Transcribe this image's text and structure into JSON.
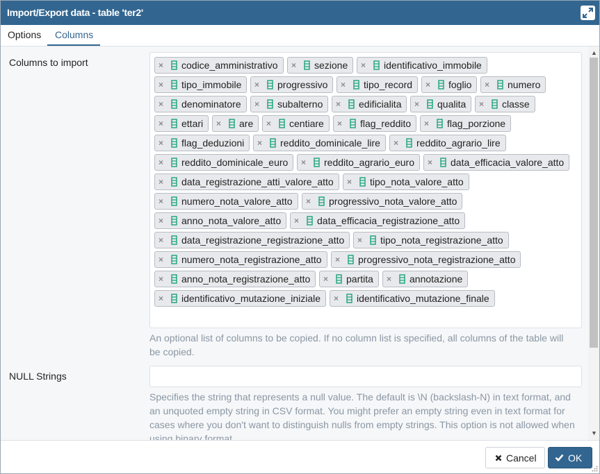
{
  "title": "Import/Export data - table 'ter2'",
  "tabs": [
    {
      "label": "Options",
      "active": false
    },
    {
      "label": "Columns",
      "active": true
    }
  ],
  "columns_label": "Columns to import",
  "columns": [
    "codice_amministrativo",
    "sezione",
    "identificativo_immobile",
    "tipo_immobile",
    "progressivo",
    "tipo_record",
    "foglio",
    "numero",
    "denominatore",
    "subalterno",
    "edificialita",
    "qualita",
    "classe",
    "ettari",
    "are",
    "centiare",
    "flag_reddito",
    "flag_porzione",
    "flag_deduzioni",
    "reddito_dominicale_lire",
    "reddito_agrario_lire",
    "reddito_dominicale_euro",
    "reddito_agrario_euro",
    "data_efficacia_valore_atto",
    "data_registrazione_atti_valore_atto",
    "tipo_nota_valore_atto",
    "numero_nota_valore_atto",
    "progressivo_nota_valore_atto",
    "anno_nota_valore_atto",
    "data_efficacia_registrazione_atto",
    "data_registrazione_registrazione_atto",
    "tipo_nota_registrazione_atto",
    "numero_nota_registrazione_atto",
    "progressivo_nota_registrazione_atto",
    "anno_nota_registrazione_atto",
    "partita",
    "annotazione",
    "identificativo_mutazione_iniziale",
    "identificativo_mutazione_finale"
  ],
  "columns_help": [
    "An optional list of columns to be copied. If no column list is specified, all columns of the table will",
    "be copied."
  ],
  "null_label": "NULL Strings",
  "null_value": "",
  "null_help": [
    "Specifies the string that represents a null value. The default is \\N (backslash-N) in text format, and",
    "an unquoted empty string in CSV format. You might prefer an empty string even in text format for",
    "cases where you don't want to distinguish nulls from empty strings. This option is not allowed when",
    "using binary format."
  ],
  "buttons": {
    "cancel": "Cancel",
    "ok": "OK"
  },
  "icons": {
    "maximize": "maximize-icon",
    "remove": "close-icon",
    "column": "column-icon",
    "cancel": "close-icon",
    "ok": "check-icon",
    "resize": "resize-grip-icon"
  },
  "colors": {
    "titlebar": "#326690",
    "accent": "#326690",
    "column_icon": "#1aa37a",
    "help_text": "#8a97a3"
  }
}
